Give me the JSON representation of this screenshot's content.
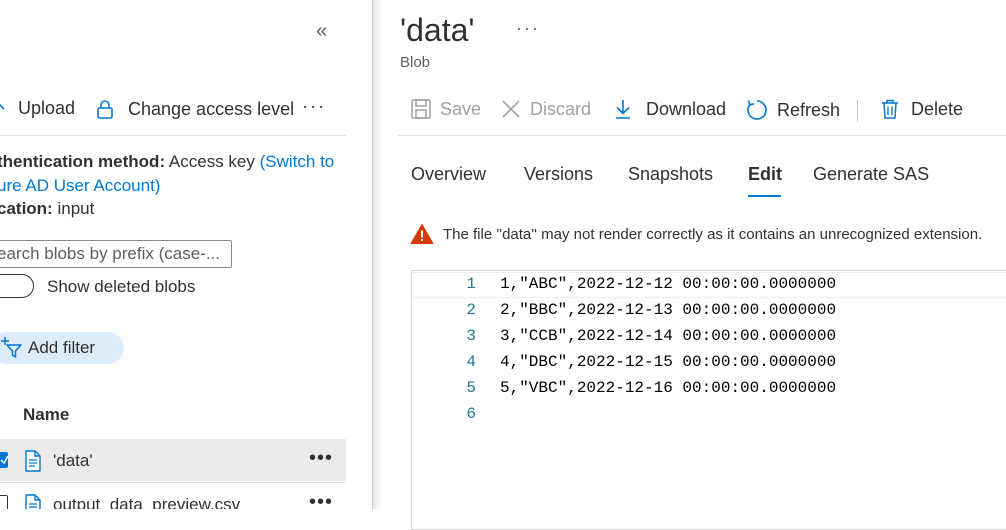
{
  "left_panel": {
    "toolbar": {
      "upload_label": "Upload",
      "access_label": "Change access level",
      "more_label": "···"
    },
    "auth": {
      "method_label": "thentication method:",
      "method_value": "Access key",
      "switch_link_1": "(Switch to",
      "switch_link_2": "ure AD User Account)",
      "location_label": "cation:",
      "location_value": "input"
    },
    "search": {
      "placeholder": "earch blobs by prefix (case-..."
    },
    "show_deleted_label": "Show deleted blobs",
    "add_filter_label": "Add filter",
    "column_name": "Name",
    "rows": [
      {
        "name": "'data'",
        "selected": true
      },
      {
        "name": "output_data_preview.csv",
        "selected": false
      }
    ]
  },
  "blob": {
    "title": "'data'",
    "subtitle": "Blob",
    "more_label": "···"
  },
  "toolbar": {
    "save_label": "Save",
    "discard_label": "Discard",
    "download_label": "Download",
    "refresh_label": "Refresh",
    "delete_label": "Delete"
  },
  "tabs": [
    {
      "label": "Overview",
      "active": false
    },
    {
      "label": "Versions",
      "active": false
    },
    {
      "label": "Snapshots",
      "active": false
    },
    {
      "label": "Edit",
      "active": true
    },
    {
      "label": "Generate SAS",
      "active": false
    }
  ],
  "warning_text": "The file ''data'' may not render correctly as it contains an unrecognized extension.",
  "editor": {
    "lines": [
      {
        "num": "1",
        "text": "1,\"ABC\",2022-12-12 00:00:00.0000000"
      },
      {
        "num": "2",
        "text": "2,\"BBC\",2022-12-13 00:00:00.0000000"
      },
      {
        "num": "3",
        "text": "3,\"CCB\",2022-12-14 00:00:00.0000000"
      },
      {
        "num": "4",
        "text": "4,\"DBC\",2022-12-15 00:00:00.0000000"
      },
      {
        "num": "5",
        "text": "5,\"VBC\",2022-12-16 00:00:00.0000000"
      },
      {
        "num": "6",
        "text": ""
      }
    ]
  },
  "colors": {
    "accent": "#0078d4",
    "warning": "#d83b01",
    "selected_row": "#edebe9",
    "filter_pill": "#deecf9"
  }
}
